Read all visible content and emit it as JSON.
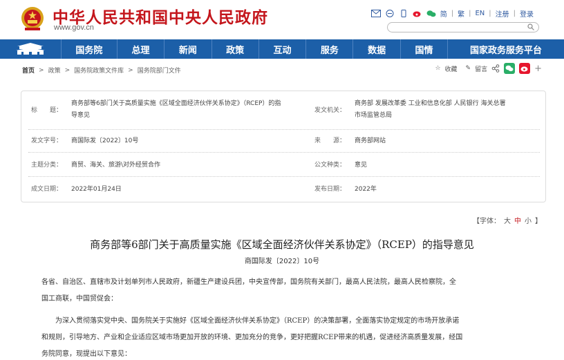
{
  "header": {
    "site_title": "中华人民共和国中央人民政府",
    "site_url": "www.gov.cn",
    "links": [
      "简",
      "繁",
      "EN",
      "注册",
      "登录"
    ]
  },
  "nav": {
    "items": [
      "国务院",
      "总理",
      "新闻",
      "政策",
      "互动",
      "服务",
      "数据",
      "国情",
      "国家政务服务平台"
    ]
  },
  "breadcrumb": [
    "首页",
    "政策",
    "国务院政策文件库",
    "国务院部门文件"
  ],
  "tools": {
    "favorite": "收藏",
    "comment": "留言"
  },
  "meta": {
    "title_label": "标　　题：",
    "title_value_1": "商务部等6部门关于高质量实施《区域全面经济伙伴关系协定》（RCEP）的指",
    "title_value_2": "导意见",
    "org_label": "发文机关：",
    "org_value_1": "商务部 发展改革委 工业和信息化部 人民银行 海关总署",
    "org_value_2": "市场监管总局",
    "docno_label": "发文字号：",
    "docno_value": "商国际发〔2022〕10号",
    "source_label": "来　　源：",
    "source_value": "商务部网站",
    "topic_label": "主题分类：",
    "topic_value": "商贸、海关、旅游\\对外经贸合作",
    "type_label": "公文种类：",
    "type_value": "意见",
    "written_label": "成文日期：",
    "written_value": "2022年01月24日",
    "publish_label": "发布日期：",
    "publish_value": "2022年"
  },
  "fontsize": {
    "prefix": "【字体：",
    "large": "大",
    "medium": "中",
    "small": "小",
    "suffix": "】"
  },
  "document": {
    "title": "商务部等6部门关于高质量实施《区域全面经济伙伴关系协定》（RCEP）的指导意见",
    "number": "商国际发〔2022〕10号",
    "p1_line1": "各省、自治区、直辖市及计划单列市人民政府，新疆生产建设兵团，中央宣传部，国务院有关部门，最高人民法院，最高人民检察院，全",
    "p1_line2": "国工商联，中国贸促会：",
    "p2_line1": "　　为深入贯彻落实党中央、国务院关于实施好《区域全面经济伙伴关系协定》（RCEP）的决策部署，全面落实协定规定的市场开放承诺",
    "p2_line2": "和规则，引导地方、产业和企业适应区域市场更加开放的环境、更加充分的竞争，更好把握RCEP带来的机遇，促进经济高质量发展，经国",
    "p2_line3": "务院同意，现提出以下意见："
  },
  "colors": {
    "brand_red": "#c4161c",
    "nav_blue": "#1c5fa8"
  }
}
